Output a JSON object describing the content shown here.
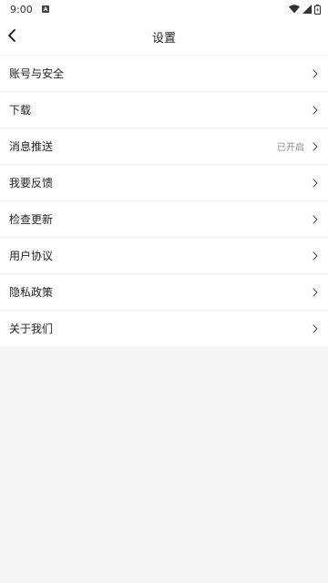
{
  "status_bar": {
    "time": "9:00",
    "app_icon": "notification-a-icon",
    "icons": [
      "wifi-icon",
      "signal-icon",
      "battery-icon"
    ]
  },
  "header": {
    "back_icon": "chevron-left-icon",
    "title": "设置"
  },
  "settings": {
    "items": [
      {
        "label": "账号与安全",
        "value": ""
      },
      {
        "label": "下载",
        "value": ""
      },
      {
        "label": "消息推送",
        "value": "已开启"
      },
      {
        "label": "我要反馈",
        "value": ""
      },
      {
        "label": "检查更新",
        "value": ""
      },
      {
        "label": "用户协议",
        "value": ""
      },
      {
        "label": "隐私政策",
        "value": ""
      },
      {
        "label": "关于我们",
        "value": ""
      }
    ],
    "chevron_icon": "chevron-right-icon"
  },
  "colors": {
    "background": "#f5f5f5",
    "surface": "#ffffff",
    "text": "#222222",
    "secondary_text": "#8a8a8a"
  }
}
